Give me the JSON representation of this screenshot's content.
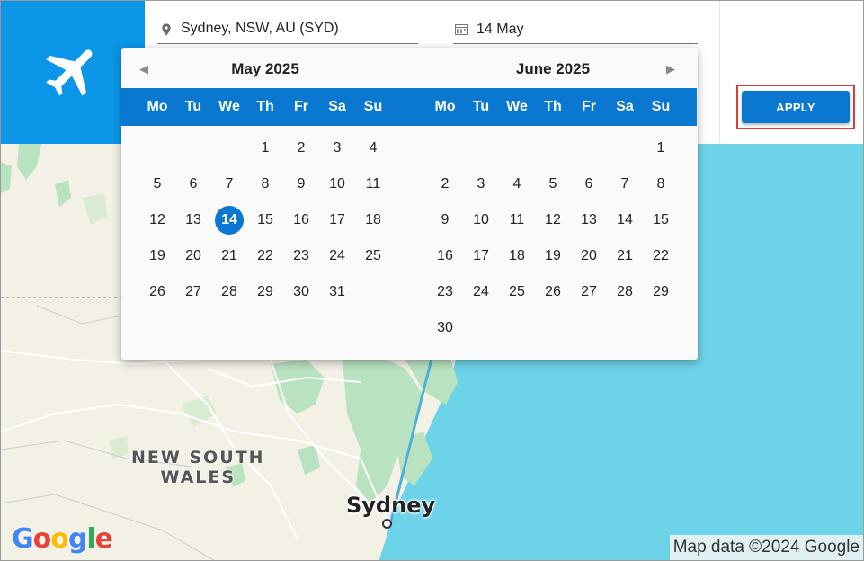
{
  "header": {
    "origin": {
      "value": "Sydney, NSW, AU (SYD)",
      "icon": "location-pin-icon"
    },
    "date": {
      "value": "14 May",
      "icon": "calendar-icon"
    },
    "apply_label": "APPLY",
    "plane_icon": "airplane-icon",
    "accent_color": "#0b96e8",
    "button_color": "#0a78d0",
    "highlight_color": "#e53935"
  },
  "datepicker": {
    "weekdays": [
      "Mo",
      "Tu",
      "We",
      "Th",
      "Fr",
      "Sa",
      "Su"
    ],
    "months": [
      {
        "title": "May 2025",
        "first_weekday": 3,
        "days": 31,
        "selected": 14
      },
      {
        "title": "June 2025",
        "first_weekday": 6,
        "days": 30,
        "selected": null
      }
    ],
    "prev_icon": "chevron-left-icon",
    "next_icon": "chevron-right-icon"
  },
  "map": {
    "state_label_line1": "NEW SOUTH",
    "state_label_line2": "WALES",
    "city_label": "Sydney",
    "attribution": "Map data ©2024 Google",
    "logo_text": "Google"
  }
}
